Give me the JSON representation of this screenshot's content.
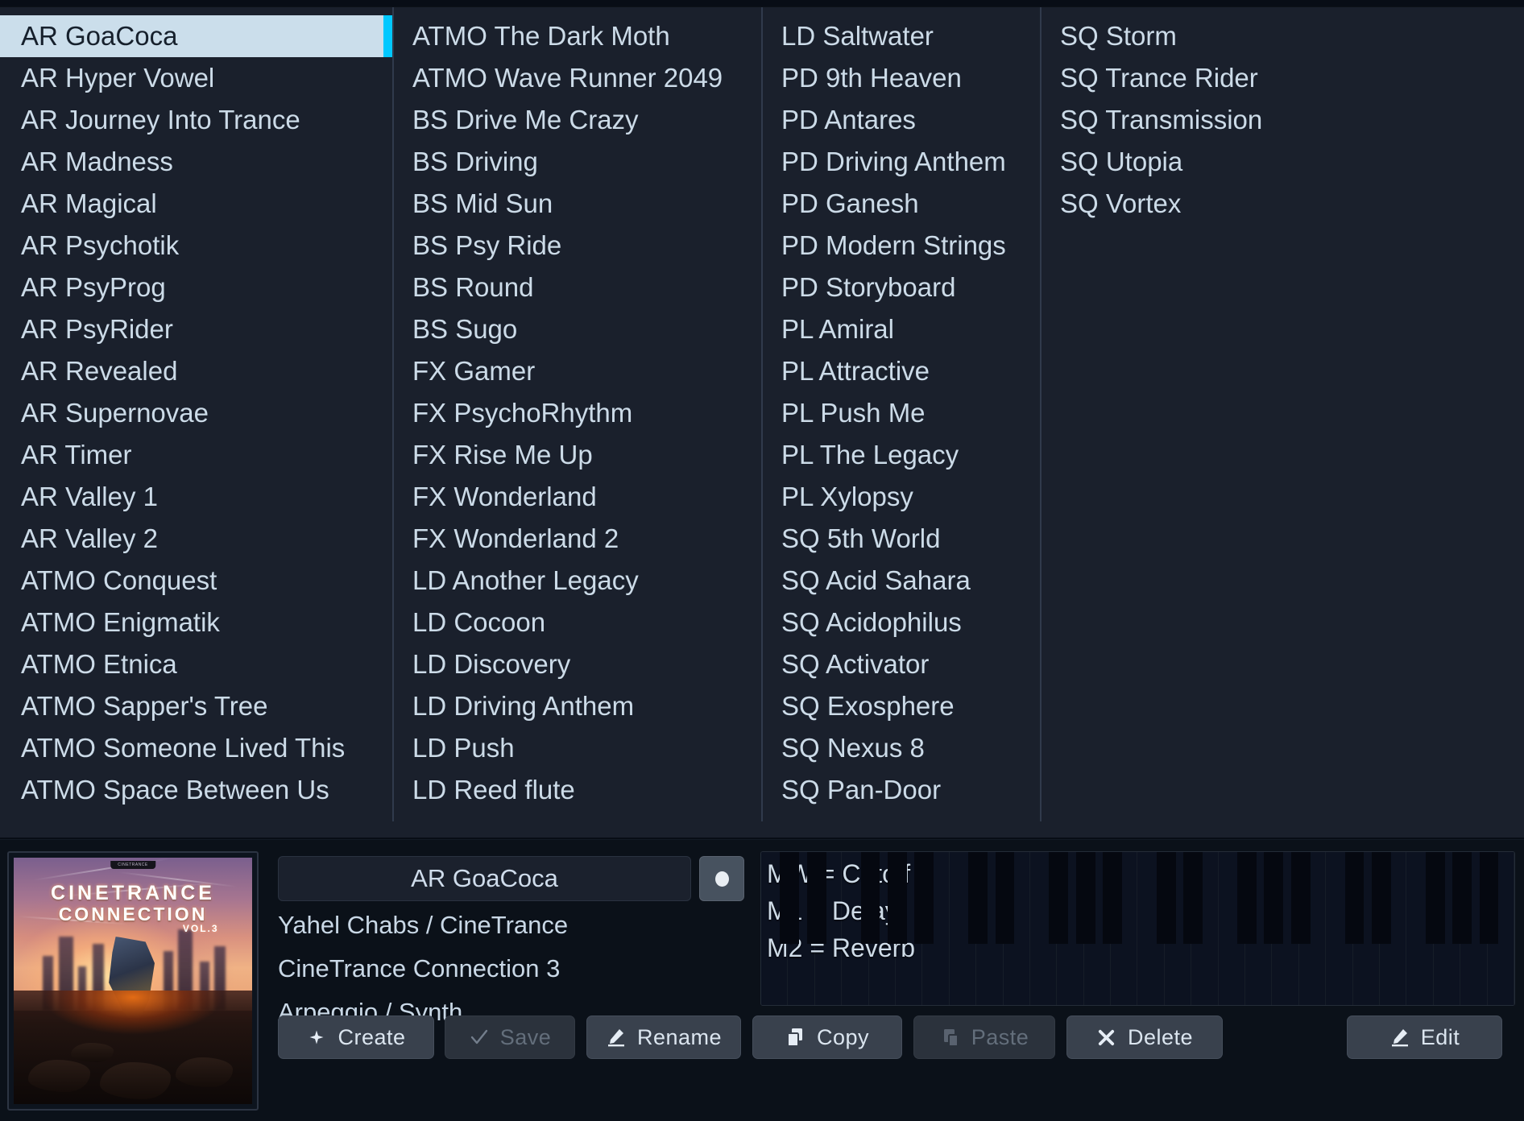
{
  "browser": {
    "selected_preset": "AR GoaCoca",
    "columns": [
      {
        "items": [
          "AR GoaCoca",
          "AR Hyper Vowel",
          "AR Journey Into Trance",
          "AR Madness",
          "AR Magical",
          "AR Psychotik",
          "AR PsyProg",
          "AR PsyRider",
          "AR Revealed",
          "AR Supernovae",
          "AR Timer",
          "AR Valley 1",
          "AR Valley 2",
          "ATMO Conquest",
          "ATMO Enigmatik",
          "ATMO Etnica",
          "ATMO Sapper's Tree",
          "ATMO Someone Lived This",
          "ATMO Space Between Us"
        ]
      },
      {
        "items": [
          "ATMO The Dark Moth",
          "ATMO Wave Runner 2049",
          "BS Drive Me Crazy",
          "BS Driving",
          "BS Mid Sun",
          "BS Psy Ride",
          "BS Round",
          "BS Sugo",
          "FX Gamer",
          "FX PsychoRhythm",
          "FX Rise Me Up",
          "FX Wonderland",
          "FX Wonderland 2",
          "LD Another Legacy",
          "LD Cocoon",
          "LD Discovery",
          "LD Driving Anthem",
          "LD Push",
          "LD Reed flute"
        ]
      },
      {
        "items": [
          "LD Saltwater",
          "PD 9th Heaven",
          "PD Antares",
          "PD Driving Anthem",
          "PD Ganesh",
          "PD Modern Strings",
          "PD Storyboard",
          "PL Amiral",
          "PL Attractive",
          "PL Push Me",
          "PL The Legacy",
          "PL Xylopsy",
          "SQ 5th World",
          "SQ Acid Sahara",
          "SQ Acidophilus",
          "SQ Activator",
          "SQ Exosphere",
          "SQ Nexus 8",
          "SQ Pan-Door"
        ]
      },
      {
        "items": [
          "SQ Storm",
          "SQ Trance Rider",
          "SQ Transmission",
          "SQ Utopia",
          "SQ Vortex"
        ]
      }
    ]
  },
  "detail": {
    "artwork": {
      "brand_tag": "CINETRANCE",
      "title_line1": "CINETRANCE",
      "title_line2": "CONNECTION",
      "volume": "VOL.3"
    },
    "preset_name": "AR GoaCoca",
    "author": "Yahel Chabs / CineTrance",
    "bank": "CineTrance Connection 3",
    "category": "Arpeggio / Synth",
    "modulation": {
      "mw": "MW = Cutoff",
      "m1": "M1 = Delay",
      "m2": "M2 = Reverb"
    }
  },
  "buttons": {
    "create": "Create",
    "save": "Save",
    "rename": "Rename",
    "copy": "Copy",
    "paste": "Paste",
    "delete": "Delete",
    "edit": "Edit"
  },
  "colors": {
    "selection_bg": "#cbdeeb",
    "selection_marker": "#00c8ff",
    "panel_bg": "#1a202c",
    "detail_bg": "#0b1119",
    "text": "#ccdbe8"
  }
}
